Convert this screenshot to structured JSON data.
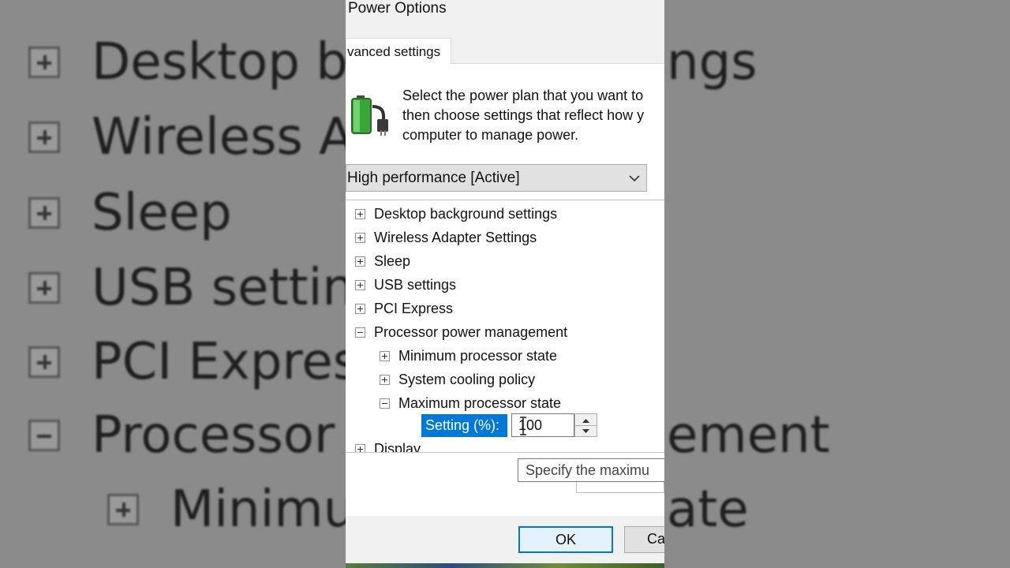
{
  "dialog": {
    "title": "Power Options",
    "tab_label": "vanced settings",
    "description_lines": [
      "Select the power plan that you want to",
      "then choose settings that reflect how y",
      "computer to manage power."
    ],
    "plan_selected": "High performance [Active]",
    "icons": {
      "battery": "battery-plug-icon",
      "dropdown": "chevron-down-icon",
      "expand": "plus-box-icon",
      "collapse": "minus-box-icon",
      "spinner_up": "arrow-up-icon",
      "spinner_down": "arrow-down-icon",
      "text_cursor": "i-beam-cursor-icon"
    },
    "tree": {
      "desktop_background": "Desktop background settings",
      "wireless_adapter": "Wireless Adapter Settings",
      "sleep": "Sleep",
      "usb": "USB settings",
      "pci_express": "PCI Express",
      "processor_power": "Processor power management",
      "min_processor_state": "Minimum processor state",
      "system_cooling": "System cooling policy",
      "max_processor_state": "Maximum processor state",
      "setting_label": "Setting (%):",
      "setting_value": "100",
      "display": "Display"
    },
    "tooltip": "Specify the maximu",
    "ok_label": "OK",
    "cancel_label": "Ca"
  },
  "backdrop": {
    "rows": [
      {
        "left": "Desktop ba",
        "right": "ngs"
      },
      {
        "left": "Wireless Ad",
        "right": ""
      },
      {
        "left": "Sleep",
        "right": ""
      },
      {
        "left": "USB settings",
        "right": ""
      },
      {
        "left": "PCI Express",
        "right": ""
      },
      {
        "left": "Processor p",
        "right": "ement"
      },
      {
        "left": "Minimu",
        "right": "ate"
      }
    ]
  },
  "colors": {
    "accent": "#0078d7",
    "dialog_bg": "#f0f0f0",
    "panel_bg": "#ffffff"
  }
}
